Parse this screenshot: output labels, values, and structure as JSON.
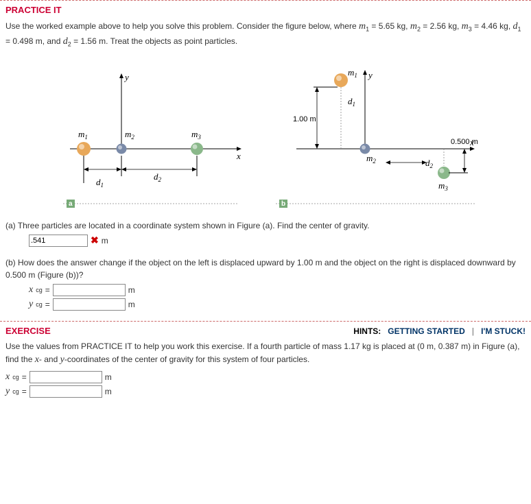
{
  "practice": {
    "title": "PRACTICE IT",
    "desc_pre": "Use the worked example above to help you solve this problem. Consider the figure below, where ",
    "m1_var": "m",
    "sub1": "1",
    "eq1": " = 5.65 kg, ",
    "m2_var": "m",
    "sub2": "2",
    "eq2": " = 2.56 kg, ",
    "m3_var": "m",
    "sub3": "3",
    "eq3": " = 4.46 kg, ",
    "d1_var": "d",
    "subd1": "1",
    "eqd1": " = 0.498 m, and ",
    "d2_var": "d",
    "subd2": "2",
    "eqd2": " = 1.56 m. Treat the objects as point particles.",
    "qa": "(a) Three particles are located in a coordinate system shown in Figure (a). Find the center of gravity.",
    "a_answer": ".541",
    "a_unit": "m",
    "qb": "(b) How does the answer change if the object on the left is displaced upward by 1.00 m and the object on the right is displaced downward by 0.500 m (Figure (b))?",
    "xcg_var": "x",
    "ycg_var": "y",
    "cg_sub": "cg",
    "eqsign": " = ",
    "m_unit": "m"
  },
  "diagram": {
    "m1": "m",
    "m2": "m",
    "m3": "m",
    "s1": "1",
    "s2": "2",
    "s3": "3",
    "d1": "d",
    "d2": "d",
    "ds1": "1",
    "ds2": "2",
    "x": "x",
    "y": "y",
    "one_m": "1.00 m",
    "half_m": "0.500 m",
    "a": "a",
    "b": "b"
  },
  "exercise": {
    "title": "EXERCISE",
    "hints_label": "HINTS:",
    "gs": "GETTING STARTED",
    "sep": "|",
    "stuck": "I'M STUCK!",
    "desc_pre": "Use the values from PRACTICE IT to help you work this exercise. If a fourth particle of mass 1.17 kg is placed at (0 m, 0.387 m) in Figure (a), find the ",
    "xv": "x",
    "mid": "- and ",
    "yv": "y",
    "desc_post": "-coordinates of the center of gravity for this system of four particles.",
    "m_unit": "m"
  }
}
